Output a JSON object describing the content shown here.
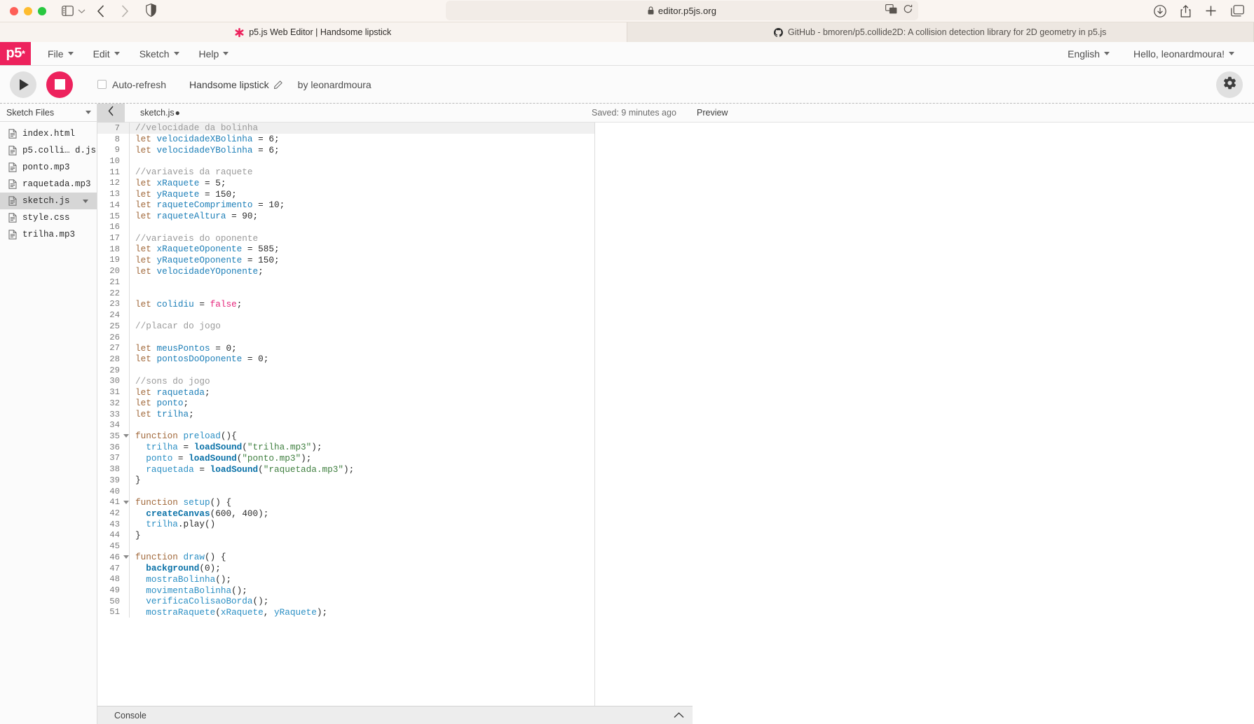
{
  "browser": {
    "url": "editor.p5js.org",
    "lock_icon": "lock-icon",
    "tabs": [
      {
        "label": "p5.js Web Editor | Handsome lipstick",
        "favicon": "p5-asterisk-icon",
        "active": true
      },
      {
        "label": "GitHub - bmoren/p5.collide2D: A collision detection library for 2D geometry in p5.js",
        "favicon": "github-icon",
        "active": false
      }
    ]
  },
  "p5header": {
    "logo": "p5",
    "logo_asterisk": "*",
    "menus": [
      {
        "label": "File"
      },
      {
        "label": "Edit"
      },
      {
        "label": "Sketch"
      },
      {
        "label": "Help"
      }
    ],
    "language": "English",
    "account": "Hello, leonardmoura!"
  },
  "toolbar": {
    "play_label": "play-button",
    "stop_label": "stop-button",
    "autorefresh_label": "Auto-refresh",
    "sketch_name": "Handsome lipstick",
    "author": "by leonardmoura",
    "settings_label": "settings-button"
  },
  "sidebar": {
    "title": "Sketch Files",
    "files": [
      {
        "name": "index.html",
        "selected": false
      },
      {
        "name": "p5.colli… d.js",
        "selected": false
      },
      {
        "name": "ponto.mp3",
        "selected": false
      },
      {
        "name": "raquetada.mp3",
        "selected": false
      },
      {
        "name": "sketch.js",
        "selected": true
      },
      {
        "name": "style.css",
        "selected": false
      },
      {
        "name": "trilha.mp3",
        "selected": false
      }
    ]
  },
  "editor": {
    "filename": "sketch.js",
    "unsaved_marker": "●",
    "saved_status": "Saved: 9 minutes ago",
    "preview_label": "Preview",
    "first_line_number": 7,
    "lines": [
      {
        "n": 7,
        "fold": false,
        "active": true,
        "tokens": [
          {
            "t": "com",
            "s": "//velocidade da bolinha"
          }
        ]
      },
      {
        "n": 8,
        "fold": false,
        "active": false,
        "tokens": [
          {
            "t": "kw",
            "s": "let"
          },
          {
            "t": "punc",
            "s": " "
          },
          {
            "t": "var",
            "s": "velocidadeXBolinha"
          },
          {
            "t": "punc",
            "s": " = "
          },
          {
            "t": "num",
            "s": "6"
          },
          {
            "t": "punc",
            "s": ";"
          }
        ]
      },
      {
        "n": 9,
        "fold": false,
        "active": false,
        "tokens": [
          {
            "t": "kw",
            "s": "let"
          },
          {
            "t": "punc",
            "s": " "
          },
          {
            "t": "var",
            "s": "velocidadeYBolinha"
          },
          {
            "t": "punc",
            "s": " = "
          },
          {
            "t": "num",
            "s": "6"
          },
          {
            "t": "punc",
            "s": ";"
          }
        ]
      },
      {
        "n": 10,
        "fold": false,
        "active": false,
        "tokens": []
      },
      {
        "n": 11,
        "fold": false,
        "active": false,
        "tokens": [
          {
            "t": "com",
            "s": "//variaveis da raquete"
          }
        ]
      },
      {
        "n": 12,
        "fold": false,
        "active": false,
        "tokens": [
          {
            "t": "kw",
            "s": "let"
          },
          {
            "t": "punc",
            "s": " "
          },
          {
            "t": "var",
            "s": "xRaquete"
          },
          {
            "t": "punc",
            "s": " = "
          },
          {
            "t": "num",
            "s": "5"
          },
          {
            "t": "punc",
            "s": ";"
          }
        ]
      },
      {
        "n": 13,
        "fold": false,
        "active": false,
        "tokens": [
          {
            "t": "kw",
            "s": "let"
          },
          {
            "t": "punc",
            "s": " "
          },
          {
            "t": "var",
            "s": "yRaquete"
          },
          {
            "t": "punc",
            "s": " = "
          },
          {
            "t": "num",
            "s": "150"
          },
          {
            "t": "punc",
            "s": ";"
          }
        ]
      },
      {
        "n": 14,
        "fold": false,
        "active": false,
        "tokens": [
          {
            "t": "kw",
            "s": "let"
          },
          {
            "t": "punc",
            "s": " "
          },
          {
            "t": "var",
            "s": "raqueteComprimento"
          },
          {
            "t": "punc",
            "s": " = "
          },
          {
            "t": "num",
            "s": "10"
          },
          {
            "t": "punc",
            "s": ";"
          }
        ]
      },
      {
        "n": 15,
        "fold": false,
        "active": false,
        "tokens": [
          {
            "t": "kw",
            "s": "let"
          },
          {
            "t": "punc",
            "s": " "
          },
          {
            "t": "var",
            "s": "raqueteAltura"
          },
          {
            "t": "punc",
            "s": " = "
          },
          {
            "t": "num",
            "s": "90"
          },
          {
            "t": "punc",
            "s": ";"
          }
        ]
      },
      {
        "n": 16,
        "fold": false,
        "active": false,
        "tokens": []
      },
      {
        "n": 17,
        "fold": false,
        "active": false,
        "tokens": [
          {
            "t": "com",
            "s": "//variaveis do oponente"
          }
        ]
      },
      {
        "n": 18,
        "fold": false,
        "active": false,
        "tokens": [
          {
            "t": "kw",
            "s": "let"
          },
          {
            "t": "punc",
            "s": " "
          },
          {
            "t": "var",
            "s": "xRaqueteOponente"
          },
          {
            "t": "punc",
            "s": " = "
          },
          {
            "t": "num",
            "s": "585"
          },
          {
            "t": "punc",
            "s": ";"
          }
        ]
      },
      {
        "n": 19,
        "fold": false,
        "active": false,
        "tokens": [
          {
            "t": "kw",
            "s": "let"
          },
          {
            "t": "punc",
            "s": " "
          },
          {
            "t": "var",
            "s": "yRaqueteOponente"
          },
          {
            "t": "punc",
            "s": " = "
          },
          {
            "t": "num",
            "s": "150"
          },
          {
            "t": "punc",
            "s": ";"
          }
        ]
      },
      {
        "n": 20,
        "fold": false,
        "active": false,
        "tokens": [
          {
            "t": "kw",
            "s": "let"
          },
          {
            "t": "punc",
            "s": " "
          },
          {
            "t": "var",
            "s": "velocidadeYOponente"
          },
          {
            "t": "punc",
            "s": ";"
          }
        ]
      },
      {
        "n": 21,
        "fold": false,
        "active": false,
        "tokens": []
      },
      {
        "n": 22,
        "fold": false,
        "active": false,
        "tokens": []
      },
      {
        "n": 23,
        "fold": false,
        "active": false,
        "tokens": [
          {
            "t": "kw",
            "s": "let"
          },
          {
            "t": "punc",
            "s": " "
          },
          {
            "t": "var",
            "s": "colidiu"
          },
          {
            "t": "punc",
            "s": " = "
          },
          {
            "t": "bool",
            "s": "false"
          },
          {
            "t": "punc",
            "s": ";"
          }
        ]
      },
      {
        "n": 24,
        "fold": false,
        "active": false,
        "tokens": []
      },
      {
        "n": 25,
        "fold": false,
        "active": false,
        "tokens": [
          {
            "t": "com",
            "s": "//placar do jogo"
          }
        ]
      },
      {
        "n": 26,
        "fold": false,
        "active": false,
        "tokens": []
      },
      {
        "n": 27,
        "fold": false,
        "active": false,
        "tokens": [
          {
            "t": "kw",
            "s": "let"
          },
          {
            "t": "punc",
            "s": " "
          },
          {
            "t": "var",
            "s": "meusPontos"
          },
          {
            "t": "punc",
            "s": " = "
          },
          {
            "t": "num",
            "s": "0"
          },
          {
            "t": "punc",
            "s": ";"
          }
        ]
      },
      {
        "n": 28,
        "fold": false,
        "active": false,
        "tokens": [
          {
            "t": "kw",
            "s": "let"
          },
          {
            "t": "punc",
            "s": " "
          },
          {
            "t": "var",
            "s": "pontosDoOponente"
          },
          {
            "t": "punc",
            "s": " = "
          },
          {
            "t": "num",
            "s": "0"
          },
          {
            "t": "punc",
            "s": ";"
          }
        ]
      },
      {
        "n": 29,
        "fold": false,
        "active": false,
        "tokens": []
      },
      {
        "n": 30,
        "fold": false,
        "active": false,
        "tokens": [
          {
            "t": "com",
            "s": "//sons do jogo"
          }
        ]
      },
      {
        "n": 31,
        "fold": false,
        "active": false,
        "tokens": [
          {
            "t": "kw",
            "s": "let"
          },
          {
            "t": "punc",
            "s": " "
          },
          {
            "t": "var",
            "s": "raquetada"
          },
          {
            "t": "punc",
            "s": ";"
          }
        ]
      },
      {
        "n": 32,
        "fold": false,
        "active": false,
        "tokens": [
          {
            "t": "kw",
            "s": "let"
          },
          {
            "t": "punc",
            "s": " "
          },
          {
            "t": "var",
            "s": "ponto"
          },
          {
            "t": "punc",
            "s": ";"
          }
        ]
      },
      {
        "n": 33,
        "fold": false,
        "active": false,
        "tokens": [
          {
            "t": "kw",
            "s": "let"
          },
          {
            "t": "punc",
            "s": " "
          },
          {
            "t": "var",
            "s": "trilha"
          },
          {
            "t": "punc",
            "s": ";"
          }
        ]
      },
      {
        "n": 34,
        "fold": false,
        "active": false,
        "tokens": []
      },
      {
        "n": 35,
        "fold": true,
        "active": false,
        "tokens": [
          {
            "t": "kw",
            "s": "function"
          },
          {
            "t": "punc",
            "s": " "
          },
          {
            "t": "fn",
            "s": "preload"
          },
          {
            "t": "punc",
            "s": "(){"
          }
        ]
      },
      {
        "n": 36,
        "fold": false,
        "active": false,
        "tokens": [
          {
            "t": "punc",
            "s": "  "
          },
          {
            "t": "fn",
            "s": "trilha"
          },
          {
            "t": "punc",
            "s": " = "
          },
          {
            "t": "p5",
            "s": "loadSound"
          },
          {
            "t": "punc",
            "s": "("
          },
          {
            "t": "str",
            "s": "\"trilha.mp3\""
          },
          {
            "t": "punc",
            "s": ");"
          }
        ]
      },
      {
        "n": 37,
        "fold": false,
        "active": false,
        "tokens": [
          {
            "t": "punc",
            "s": "  "
          },
          {
            "t": "fn",
            "s": "ponto"
          },
          {
            "t": "punc",
            "s": " = "
          },
          {
            "t": "p5",
            "s": "loadSound"
          },
          {
            "t": "punc",
            "s": "("
          },
          {
            "t": "str",
            "s": "\"ponto.mp3\""
          },
          {
            "t": "punc",
            "s": ");"
          }
        ]
      },
      {
        "n": 38,
        "fold": false,
        "active": false,
        "tokens": [
          {
            "t": "punc",
            "s": "  "
          },
          {
            "t": "fn",
            "s": "raquetada"
          },
          {
            "t": "punc",
            "s": " = "
          },
          {
            "t": "p5",
            "s": "loadSound"
          },
          {
            "t": "punc",
            "s": "("
          },
          {
            "t": "str",
            "s": "\"raquetada.mp3\""
          },
          {
            "t": "punc",
            "s": ");"
          }
        ]
      },
      {
        "n": 39,
        "fold": false,
        "active": false,
        "tokens": [
          {
            "t": "punc",
            "s": "}"
          }
        ]
      },
      {
        "n": 40,
        "fold": false,
        "active": false,
        "tokens": []
      },
      {
        "n": 41,
        "fold": true,
        "active": false,
        "tokens": [
          {
            "t": "kw",
            "s": "function"
          },
          {
            "t": "punc",
            "s": " "
          },
          {
            "t": "fn",
            "s": "setup"
          },
          {
            "t": "punc",
            "s": "() {"
          }
        ]
      },
      {
        "n": 42,
        "fold": false,
        "active": false,
        "tokens": [
          {
            "t": "punc",
            "s": "  "
          },
          {
            "t": "p5",
            "s": "createCanvas"
          },
          {
            "t": "punc",
            "s": "("
          },
          {
            "t": "num",
            "s": "600"
          },
          {
            "t": "punc",
            "s": ", "
          },
          {
            "t": "num",
            "s": "400"
          },
          {
            "t": "punc",
            "s": ");"
          }
        ]
      },
      {
        "n": 43,
        "fold": false,
        "active": false,
        "tokens": [
          {
            "t": "punc",
            "s": "  "
          },
          {
            "t": "fn",
            "s": "trilha"
          },
          {
            "t": "punc",
            "s": "."
          },
          {
            "t": "prop",
            "s": "play"
          },
          {
            "t": "punc",
            "s": "()"
          }
        ]
      },
      {
        "n": 44,
        "fold": false,
        "active": false,
        "tokens": [
          {
            "t": "punc",
            "s": "}"
          }
        ]
      },
      {
        "n": 45,
        "fold": false,
        "active": false,
        "tokens": []
      },
      {
        "n": 46,
        "fold": true,
        "active": false,
        "tokens": [
          {
            "t": "kw",
            "s": "function"
          },
          {
            "t": "punc",
            "s": " "
          },
          {
            "t": "fn",
            "s": "draw"
          },
          {
            "t": "punc",
            "s": "() {"
          }
        ]
      },
      {
        "n": 47,
        "fold": false,
        "active": false,
        "tokens": [
          {
            "t": "punc",
            "s": "  "
          },
          {
            "t": "p5",
            "s": "background"
          },
          {
            "t": "punc",
            "s": "("
          },
          {
            "t": "num",
            "s": "0"
          },
          {
            "t": "punc",
            "s": ");"
          }
        ]
      },
      {
        "n": 48,
        "fold": false,
        "active": false,
        "tokens": [
          {
            "t": "punc",
            "s": "  "
          },
          {
            "t": "fn",
            "s": "mostraBolinha"
          },
          {
            "t": "punc",
            "s": "();"
          }
        ]
      },
      {
        "n": 49,
        "fold": false,
        "active": false,
        "tokens": [
          {
            "t": "punc",
            "s": "  "
          },
          {
            "t": "fn",
            "s": "movimentaBolinha"
          },
          {
            "t": "punc",
            "s": "();"
          }
        ]
      },
      {
        "n": 50,
        "fold": false,
        "active": false,
        "tokens": [
          {
            "t": "punc",
            "s": "  "
          },
          {
            "t": "fn",
            "s": "verificaColisaoBorda"
          },
          {
            "t": "punc",
            "s": "();"
          }
        ]
      },
      {
        "n": 51,
        "fold": false,
        "active": false,
        "tokens": [
          {
            "t": "punc",
            "s": "  "
          },
          {
            "t": "fn",
            "s": "mostraRaquete"
          },
          {
            "t": "punc",
            "s": "("
          },
          {
            "t": "fn",
            "s": "xRaquete"
          },
          {
            "t": "punc",
            "s": ", "
          },
          {
            "t": "fn",
            "s": "yRaquete"
          },
          {
            "t": "punc",
            "s": ");"
          }
        ]
      }
    ]
  },
  "console": {
    "label": "Console"
  },
  "colors": {
    "brand_pink": "#ed225d",
    "chrome_bg": "#faf5f1",
    "active_line": "#f0f0f0",
    "selected_file": "#d6d6d6"
  }
}
